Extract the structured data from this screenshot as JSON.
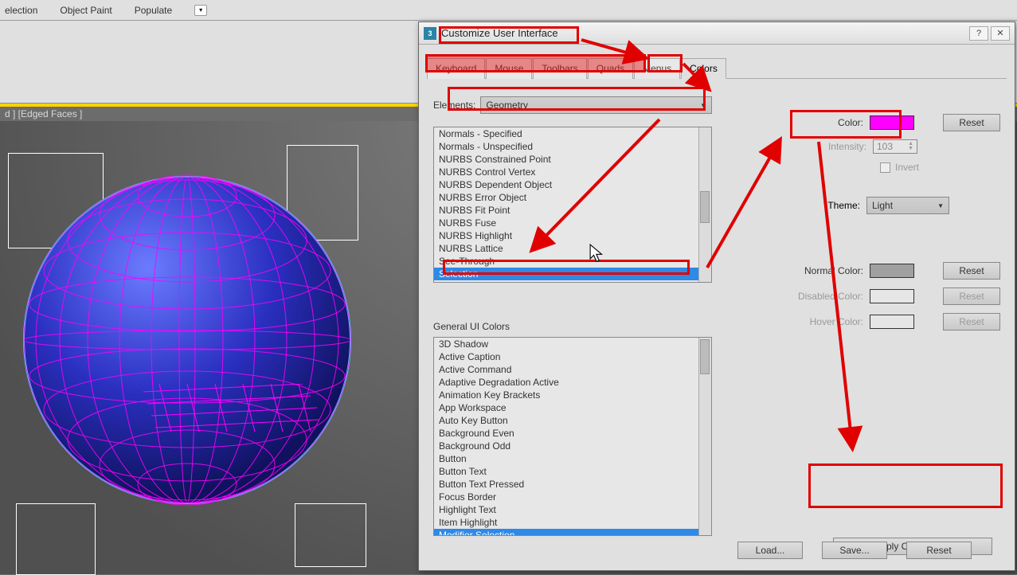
{
  "top_toolbar": {
    "items": [
      "election",
      "Object Paint",
      "Populate"
    ]
  },
  "viewport": {
    "label": "d ] [Edged Faces ]"
  },
  "dialog": {
    "title": "Customize User Interface",
    "help": "?",
    "close": "✕",
    "tabs": [
      "Keyboard",
      "Mouse",
      "Toolbars",
      "Quads",
      "Menus",
      "Colors"
    ],
    "active_tab": 5,
    "elements_label": "Elements:",
    "elements_value": "Geometry",
    "element_list": [
      "Normals - Specified",
      "Normals - Unspecified",
      "NURBS Constrained Point",
      "NURBS Control Vertex",
      "NURBS Dependent Object",
      "NURBS Error Object",
      "NURBS Fit Point",
      "NURBS Fuse",
      "NURBS Highlight",
      "NURBS Lattice",
      "See-Through",
      "Selection"
    ],
    "element_selected_index": 11,
    "general_label": "General UI Colors",
    "general_list": [
      "3D Shadow",
      "Active Caption",
      "Active Command",
      "Adaptive Degradation Active",
      "Animation Key Brackets",
      "App Workspace",
      "Auto Key Button",
      "Background Even",
      "Background Odd",
      "Button",
      "Button Text",
      "Button Text Pressed",
      "Focus Border",
      "Highlight Text",
      "Item Highlight",
      "Modifier Selection"
    ],
    "general_selected_index": 15,
    "right": {
      "color_label": "Color:",
      "reset": "Reset",
      "intensity_label": "Intensity:",
      "intensity_value": "103",
      "invert_label": "Invert",
      "theme_label": "Theme:",
      "theme_value": "Light",
      "normal_color_label": "Normal Color:",
      "disabled_color_label": "Disabled Color:",
      "hover_color_label": "Hover Color:",
      "apply_label": "Apply Colors Now"
    },
    "bottom": {
      "load": "Load...",
      "save": "Save...",
      "reset": "Reset"
    }
  }
}
